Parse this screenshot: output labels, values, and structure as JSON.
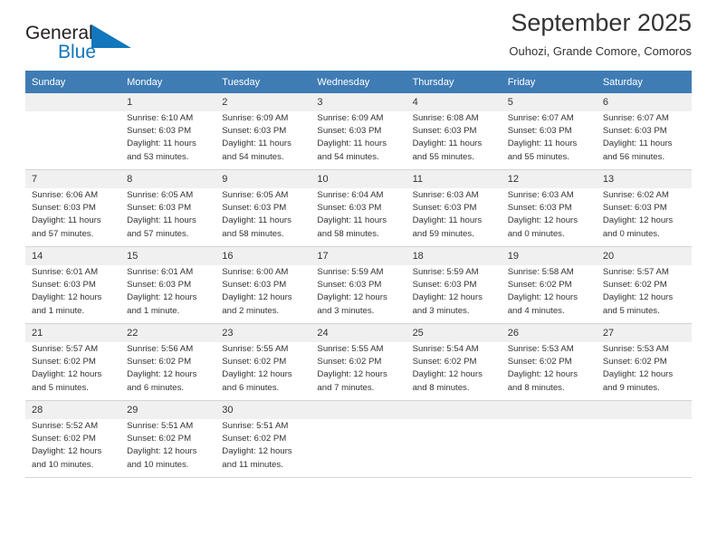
{
  "brand": {
    "name_top": "General",
    "name_bottom": "Blue",
    "triangle_color": "#1277bc",
    "text_color": "#231f20"
  },
  "header": {
    "title": "September 2025",
    "subtitle": "Ouhozi, Grande Comore, Comoros"
  },
  "colors": {
    "header_row_bg": "#3f7cb4",
    "header_row_text": "#ffffff",
    "shaded_row_bg": "#f0f0f0",
    "grid_line": "#d4d4d4",
    "body_text": "#333333"
  },
  "weekdays": [
    "Sunday",
    "Monday",
    "Tuesday",
    "Wednesday",
    "Thursday",
    "Friday",
    "Saturday"
  ],
  "weeks": [
    [
      {
        "day": "",
        "sunrise": "",
        "sunset": "",
        "daylight": ""
      },
      {
        "day": "1",
        "sunrise": "Sunrise: 6:10 AM",
        "sunset": "Sunset: 6:03 PM",
        "daylight": "Daylight: 11 hours and 53 minutes."
      },
      {
        "day": "2",
        "sunrise": "Sunrise: 6:09 AM",
        "sunset": "Sunset: 6:03 PM",
        "daylight": "Daylight: 11 hours and 54 minutes."
      },
      {
        "day": "3",
        "sunrise": "Sunrise: 6:09 AM",
        "sunset": "Sunset: 6:03 PM",
        "daylight": "Daylight: 11 hours and 54 minutes."
      },
      {
        "day": "4",
        "sunrise": "Sunrise: 6:08 AM",
        "sunset": "Sunset: 6:03 PM",
        "daylight": "Daylight: 11 hours and 55 minutes."
      },
      {
        "day": "5",
        "sunrise": "Sunrise: 6:07 AM",
        "sunset": "Sunset: 6:03 PM",
        "daylight": "Daylight: 11 hours and 55 minutes."
      },
      {
        "day": "6",
        "sunrise": "Sunrise: 6:07 AM",
        "sunset": "Sunset: 6:03 PM",
        "daylight": "Daylight: 11 hours and 56 minutes."
      }
    ],
    [
      {
        "day": "7",
        "sunrise": "Sunrise: 6:06 AM",
        "sunset": "Sunset: 6:03 PM",
        "daylight": "Daylight: 11 hours and 57 minutes."
      },
      {
        "day": "8",
        "sunrise": "Sunrise: 6:05 AM",
        "sunset": "Sunset: 6:03 PM",
        "daylight": "Daylight: 11 hours and 57 minutes."
      },
      {
        "day": "9",
        "sunrise": "Sunrise: 6:05 AM",
        "sunset": "Sunset: 6:03 PM",
        "daylight": "Daylight: 11 hours and 58 minutes."
      },
      {
        "day": "10",
        "sunrise": "Sunrise: 6:04 AM",
        "sunset": "Sunset: 6:03 PM",
        "daylight": "Daylight: 11 hours and 58 minutes."
      },
      {
        "day": "11",
        "sunrise": "Sunrise: 6:03 AM",
        "sunset": "Sunset: 6:03 PM",
        "daylight": "Daylight: 11 hours and 59 minutes."
      },
      {
        "day": "12",
        "sunrise": "Sunrise: 6:03 AM",
        "sunset": "Sunset: 6:03 PM",
        "daylight": "Daylight: 12 hours and 0 minutes."
      },
      {
        "day": "13",
        "sunrise": "Sunrise: 6:02 AM",
        "sunset": "Sunset: 6:03 PM",
        "daylight": "Daylight: 12 hours and 0 minutes."
      }
    ],
    [
      {
        "day": "14",
        "sunrise": "Sunrise: 6:01 AM",
        "sunset": "Sunset: 6:03 PM",
        "daylight": "Daylight: 12 hours and 1 minute."
      },
      {
        "day": "15",
        "sunrise": "Sunrise: 6:01 AM",
        "sunset": "Sunset: 6:03 PM",
        "daylight": "Daylight: 12 hours and 1 minute."
      },
      {
        "day": "16",
        "sunrise": "Sunrise: 6:00 AM",
        "sunset": "Sunset: 6:03 PM",
        "daylight": "Daylight: 12 hours and 2 minutes."
      },
      {
        "day": "17",
        "sunrise": "Sunrise: 5:59 AM",
        "sunset": "Sunset: 6:03 PM",
        "daylight": "Daylight: 12 hours and 3 minutes."
      },
      {
        "day": "18",
        "sunrise": "Sunrise: 5:59 AM",
        "sunset": "Sunset: 6:03 PM",
        "daylight": "Daylight: 12 hours and 3 minutes."
      },
      {
        "day": "19",
        "sunrise": "Sunrise: 5:58 AM",
        "sunset": "Sunset: 6:02 PM",
        "daylight": "Daylight: 12 hours and 4 minutes."
      },
      {
        "day": "20",
        "sunrise": "Sunrise: 5:57 AM",
        "sunset": "Sunset: 6:02 PM",
        "daylight": "Daylight: 12 hours and 5 minutes."
      }
    ],
    [
      {
        "day": "21",
        "sunrise": "Sunrise: 5:57 AM",
        "sunset": "Sunset: 6:02 PM",
        "daylight": "Daylight: 12 hours and 5 minutes."
      },
      {
        "day": "22",
        "sunrise": "Sunrise: 5:56 AM",
        "sunset": "Sunset: 6:02 PM",
        "daylight": "Daylight: 12 hours and 6 minutes."
      },
      {
        "day": "23",
        "sunrise": "Sunrise: 5:55 AM",
        "sunset": "Sunset: 6:02 PM",
        "daylight": "Daylight: 12 hours and 6 minutes."
      },
      {
        "day": "24",
        "sunrise": "Sunrise: 5:55 AM",
        "sunset": "Sunset: 6:02 PM",
        "daylight": "Daylight: 12 hours and 7 minutes."
      },
      {
        "day": "25",
        "sunrise": "Sunrise: 5:54 AM",
        "sunset": "Sunset: 6:02 PM",
        "daylight": "Daylight: 12 hours and 8 minutes."
      },
      {
        "day": "26",
        "sunrise": "Sunrise: 5:53 AM",
        "sunset": "Sunset: 6:02 PM",
        "daylight": "Daylight: 12 hours and 8 minutes."
      },
      {
        "day": "27",
        "sunrise": "Sunrise: 5:53 AM",
        "sunset": "Sunset: 6:02 PM",
        "daylight": "Daylight: 12 hours and 9 minutes."
      }
    ],
    [
      {
        "day": "28",
        "sunrise": "Sunrise: 5:52 AM",
        "sunset": "Sunset: 6:02 PM",
        "daylight": "Daylight: 12 hours and 10 minutes."
      },
      {
        "day": "29",
        "sunrise": "Sunrise: 5:51 AM",
        "sunset": "Sunset: 6:02 PM",
        "daylight": "Daylight: 12 hours and 10 minutes."
      },
      {
        "day": "30",
        "sunrise": "Sunrise: 5:51 AM",
        "sunset": "Sunset: 6:02 PM",
        "daylight": "Daylight: 12 hours and 11 minutes."
      },
      {
        "day": "",
        "sunrise": "",
        "sunset": "",
        "daylight": ""
      },
      {
        "day": "",
        "sunrise": "",
        "sunset": "",
        "daylight": ""
      },
      {
        "day": "",
        "sunrise": "",
        "sunset": "",
        "daylight": ""
      },
      {
        "day": "",
        "sunrise": "",
        "sunset": "",
        "daylight": ""
      }
    ]
  ]
}
